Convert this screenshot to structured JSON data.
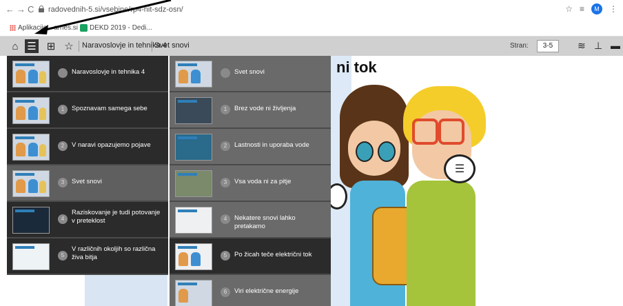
{
  "browser": {
    "url": "radovednih-5.si/vsebine/rp4-nit-sdz-osn/",
    "avatar_letter": "M",
    "bookmarks": [
      "Aplikacije",
      "arnes.si",
      "DEKD 2019 - Dedi..."
    ]
  },
  "toolbar": {
    "crumb_1": "Naravoslovje in tehnika 4",
    "crumb_2": "Svet snovi",
    "page_label": "Stran:",
    "page_value": "3-5"
  },
  "page": {
    "title_visible": "ni tok"
  },
  "menu": {
    "column_1": [
      {
        "num": "",
        "label": "Naravoslovje in tehnika 4"
      },
      {
        "num": "1",
        "label": "Spoznavam samega sebe"
      },
      {
        "num": "2",
        "label": "V naravi opazujemo pojave"
      },
      {
        "num": "3",
        "label": "Svet snovi"
      },
      {
        "num": "4",
        "label": "Raziskovanje je tudi potovanje v preteklost"
      },
      {
        "num": "5",
        "label": "V različnih okoljih so različna živa bitja"
      }
    ],
    "column_2": [
      {
        "num": "",
        "label": "Svet snovi"
      },
      {
        "num": "1",
        "label": "Brez vode ni življenja"
      },
      {
        "num": "2",
        "label": "Lastnosti in uporaba vode"
      },
      {
        "num": "3",
        "label": "Vsa voda ni za pitje"
      },
      {
        "num": "4",
        "label": "Nekatere snovi lahko pretakamo"
      },
      {
        "num": "5",
        "label": "Po žicah teče električni tok"
      },
      {
        "num": "6",
        "label": "Viri električne energije"
      }
    ]
  },
  "colors": {
    "toolbar_bg": "#d0d0d0",
    "menu_dark": "#2b2b2b",
    "menu_mid": "#6a6a6a"
  }
}
